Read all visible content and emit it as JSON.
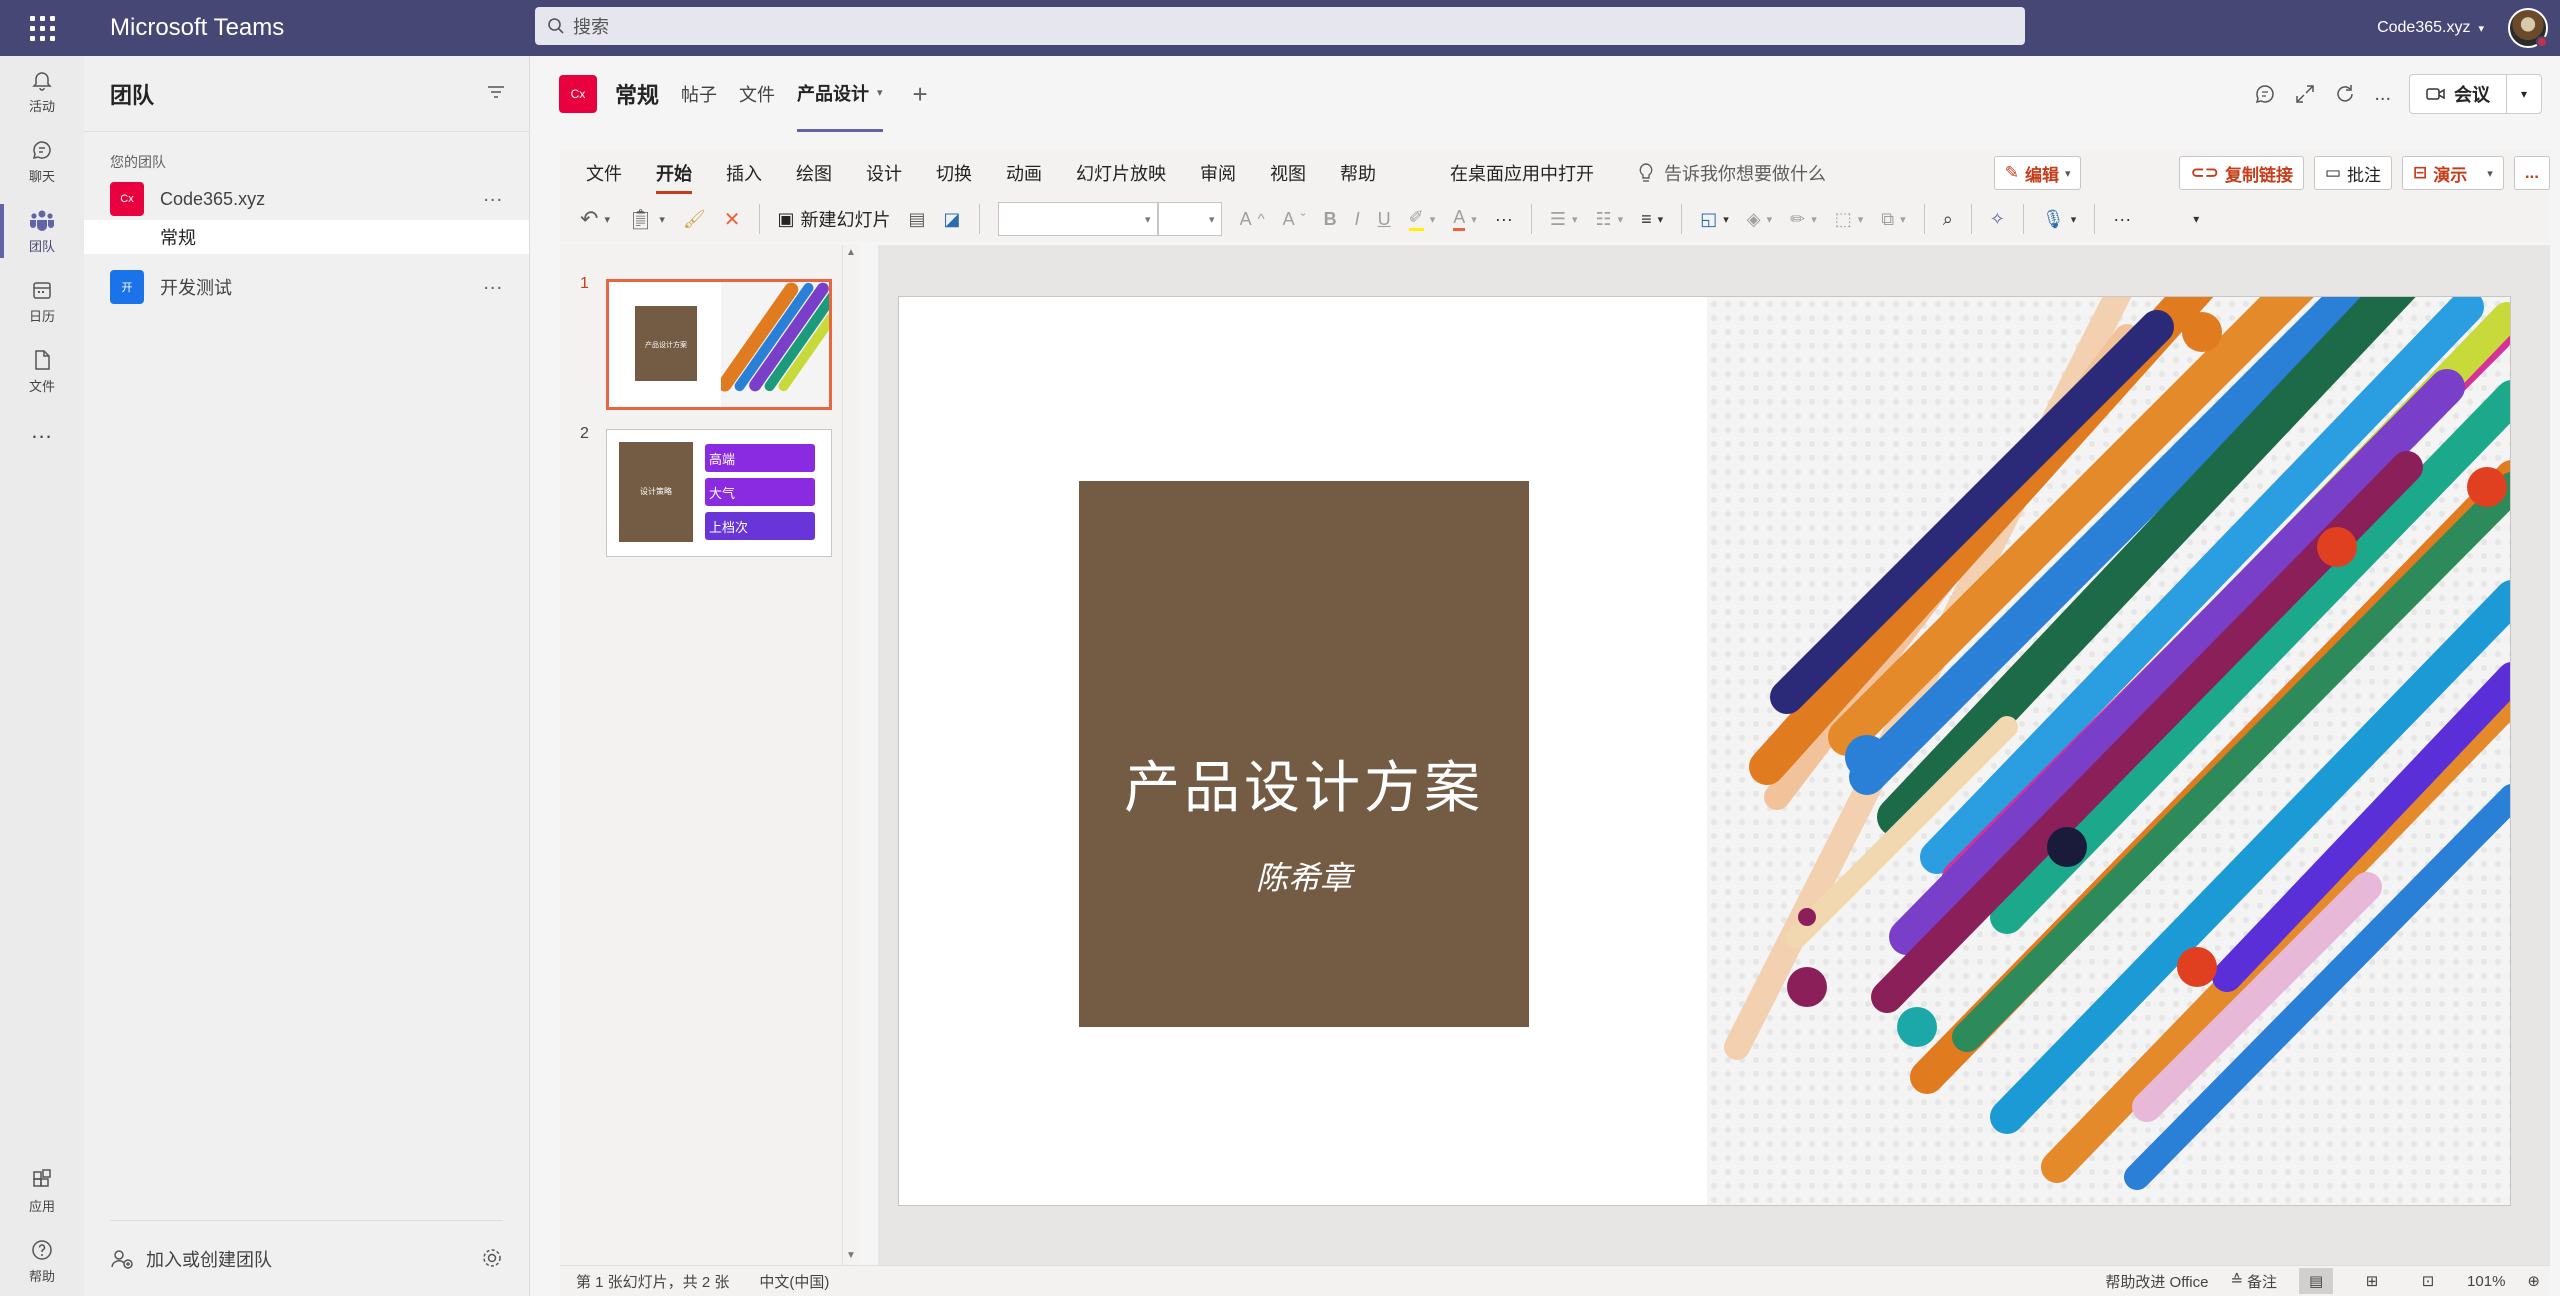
{
  "app": {
    "title": "Microsoft Teams",
    "org_name": "Code365.xyz"
  },
  "search": {
    "placeholder": "搜索"
  },
  "rail": {
    "items": [
      {
        "label": "活动",
        "icon": "bell-icon"
      },
      {
        "label": "聊天",
        "icon": "chat-icon"
      },
      {
        "label": "团队",
        "icon": "teams-icon",
        "active": true
      },
      {
        "label": "日历",
        "icon": "calendar-icon"
      },
      {
        "label": "文件",
        "icon": "file-icon"
      }
    ],
    "more": "...",
    "apps_label": "应用",
    "help_label": "帮助"
  },
  "panel": {
    "title": "团队",
    "section_label": "您的团队",
    "teams": [
      {
        "name": "Code365.xyz",
        "logo_text": "Cx",
        "logo_color": "#e8003f",
        "more": "..."
      },
      {
        "name": "开发测试",
        "logo_text": "开",
        "logo_color": "#1a73e8",
        "more": "..."
      }
    ],
    "channel": "常规",
    "join_label": "加入或创建团队"
  },
  "channel_header": {
    "logo_text": "Cx",
    "title": "常规",
    "tabs": [
      "帖子",
      "文件",
      "产品设计"
    ],
    "active_tab": "产品设计",
    "add": "+",
    "meeting_label": "会议",
    "more": "..."
  },
  "ribbon": {
    "tabs": [
      "文件",
      "开始",
      "插入",
      "绘图",
      "设计",
      "切换",
      "动画",
      "幻灯片放映",
      "审阅",
      "视图",
      "帮助"
    ],
    "active_tab": "开始",
    "open_desktop": "在桌面应用中打开",
    "tell_me": "告诉我你想要做什么",
    "edit_label": "编辑",
    "copy_link_label": "复制链接",
    "comment_label": "批注",
    "present_label": "演示",
    "new_slide_label": "新建幻灯片",
    "more": "..."
  },
  "thumbnails": [
    {
      "number": "1",
      "title": "产品设计方案"
    },
    {
      "number": "2",
      "title": "设计策略",
      "bullets": [
        "高端",
        "大气",
        "上档次"
      ]
    }
  ],
  "slide": {
    "title": "产品设计方案",
    "subtitle": "陈希章"
  },
  "status": {
    "slide_info": "第 1 张幻灯片，共 2 张",
    "language": "中文(中国)",
    "help_improve": "帮助改进 Office",
    "notes_label": "备注",
    "zoom": "101%"
  },
  "colors": {
    "teams_purple": "#464775",
    "accent": "#6264a7",
    "powerpoint_red": "#c43e1c",
    "title_box": "#745c44"
  }
}
